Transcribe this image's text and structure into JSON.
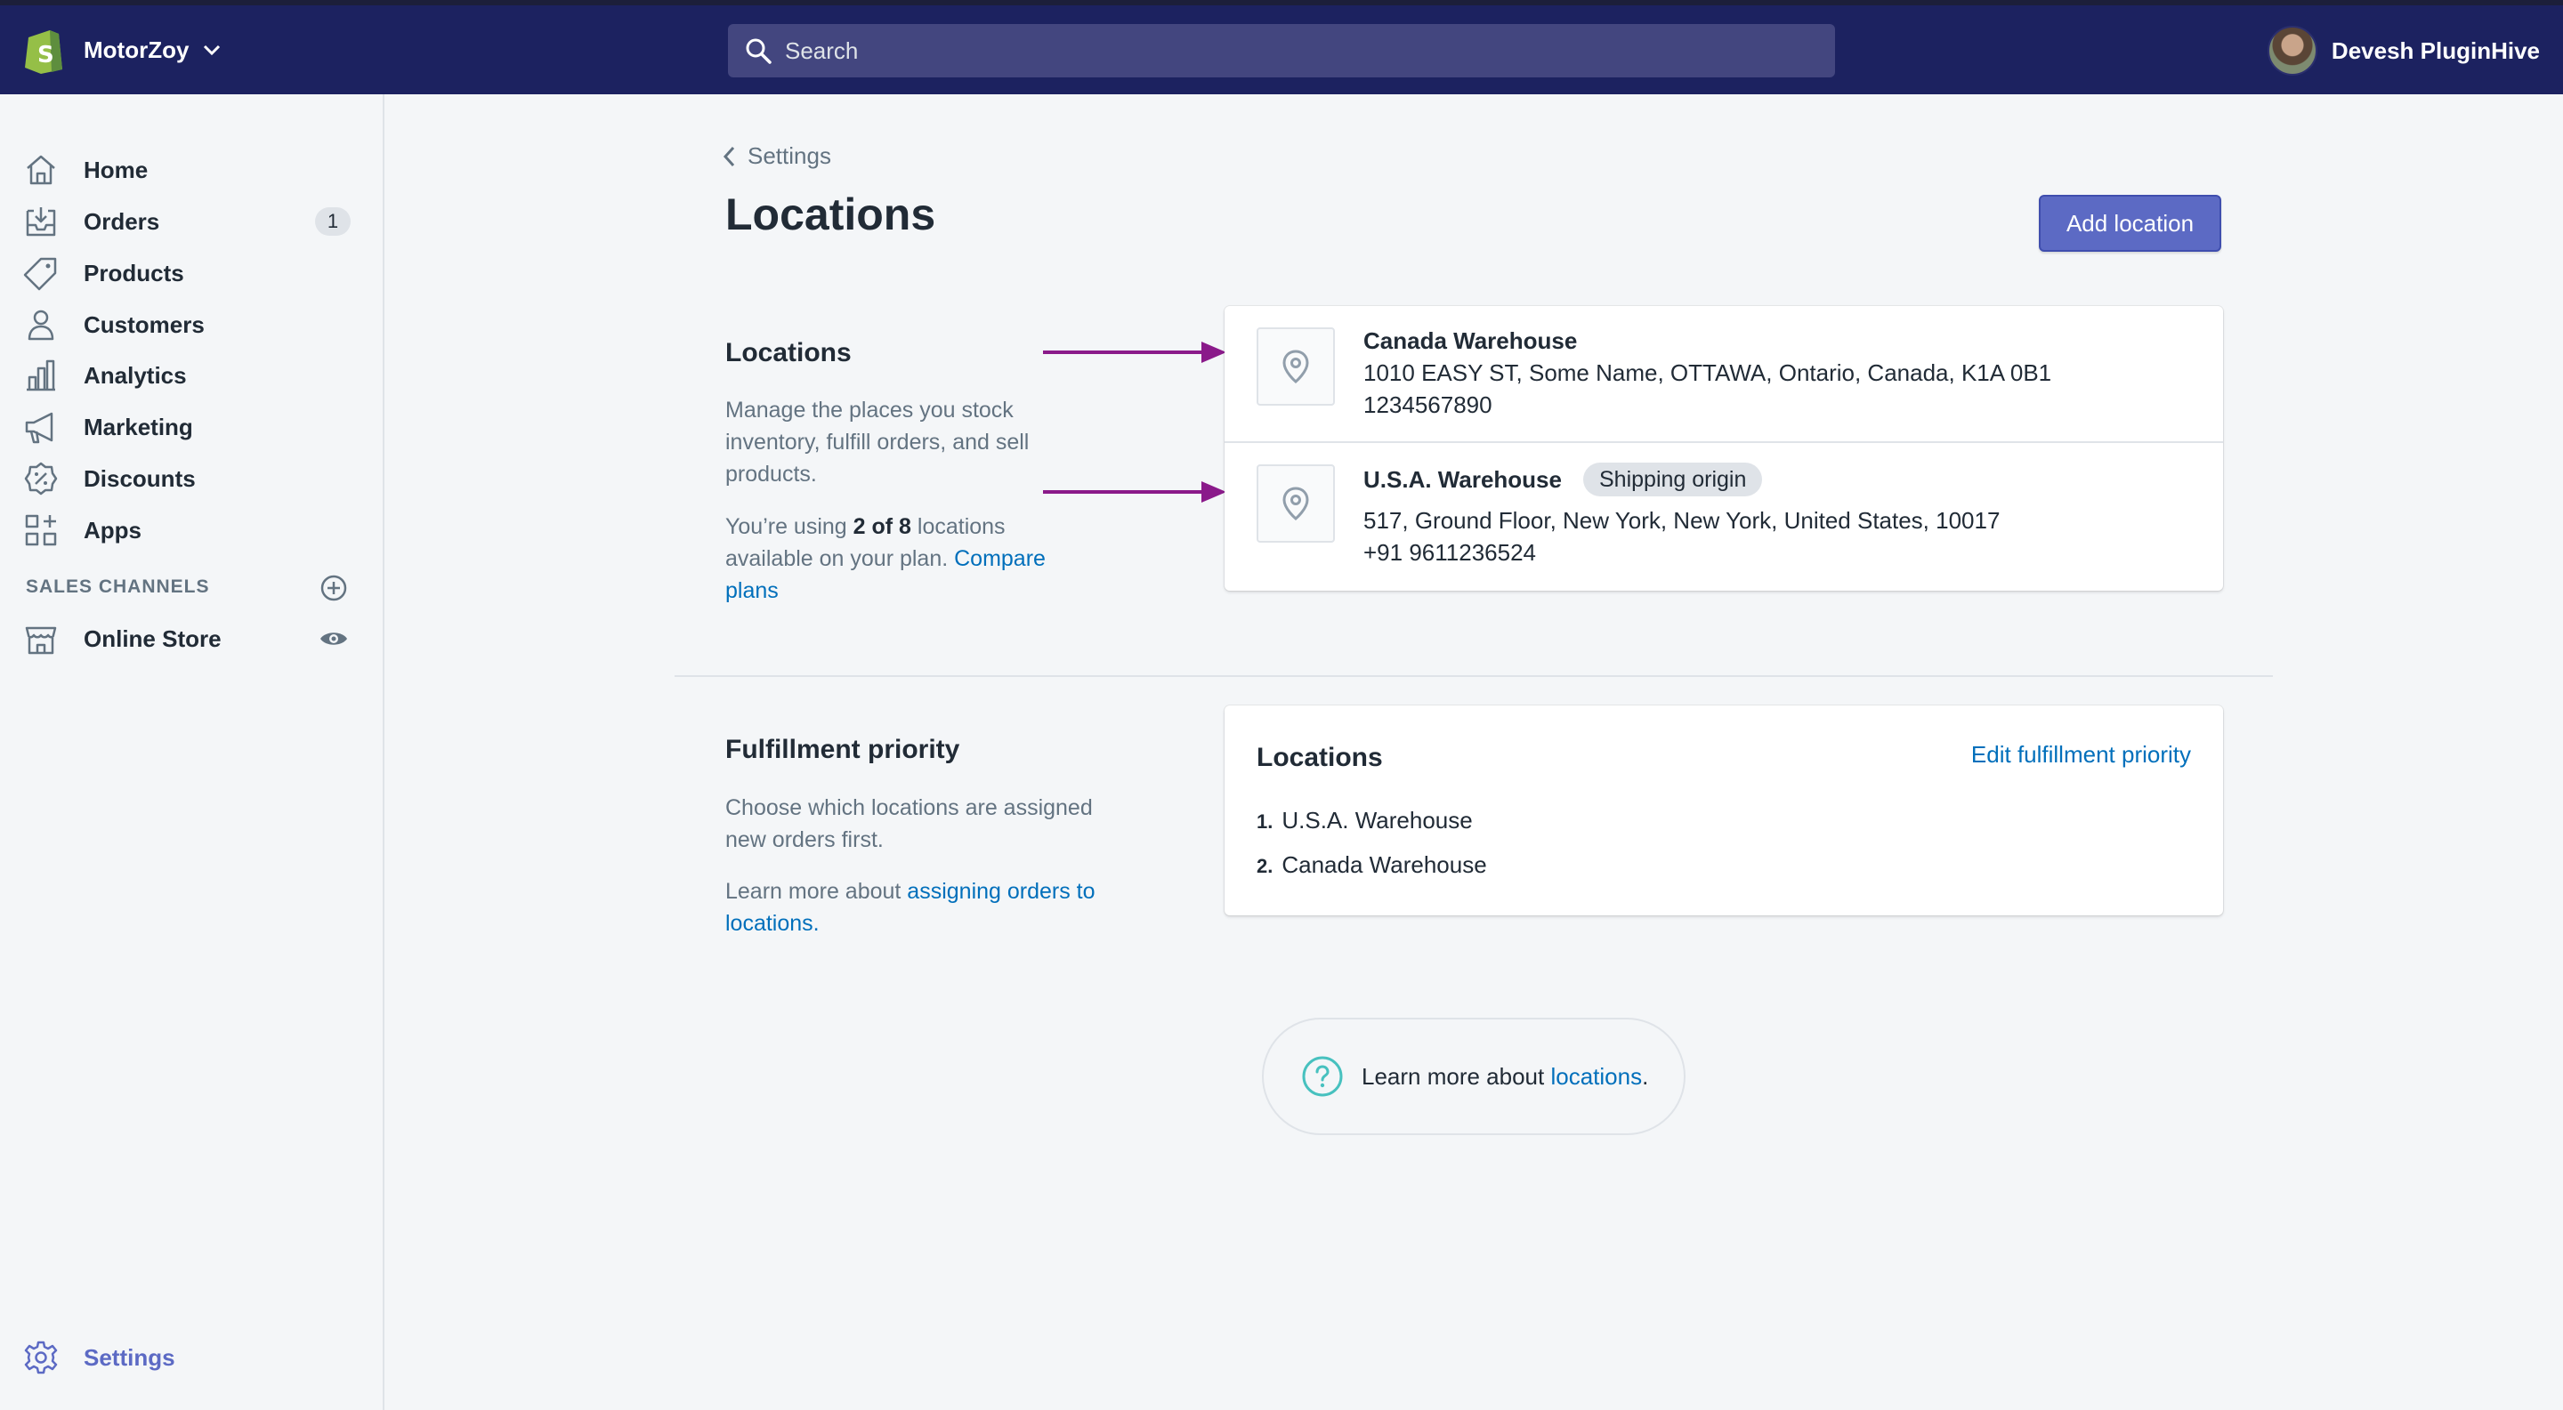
{
  "topbar": {
    "store_name": "MotorZoy",
    "search_placeholder": "Search",
    "user_name": "Devesh PluginHive"
  },
  "sidebar": {
    "items": [
      {
        "label": "Home",
        "icon": "home-icon"
      },
      {
        "label": "Orders",
        "icon": "orders-icon",
        "badge": "1"
      },
      {
        "label": "Products",
        "icon": "tag-icon"
      },
      {
        "label": "Customers",
        "icon": "person-icon"
      },
      {
        "label": "Analytics",
        "icon": "bar-chart-icon"
      },
      {
        "label": "Marketing",
        "icon": "megaphone-icon"
      },
      {
        "label": "Discounts",
        "icon": "discount-icon"
      },
      {
        "label": "Apps",
        "icon": "apps-icon"
      }
    ],
    "sales_channels_heading": "SALES CHANNELS",
    "online_store_label": "Online Store",
    "settings_label": "Settings"
  },
  "page": {
    "breadcrumb": "Settings",
    "title": "Locations",
    "add_button": "Add location"
  },
  "locations_section": {
    "heading": "Locations",
    "description": "Manage the places you stock inventory, fulfill orders, and sell products.",
    "usage_prefix": "You’re using ",
    "usage_count": "2 of 8",
    "usage_suffix": " locations available on your plan. ",
    "compare_link": "Compare plans",
    "locations": [
      {
        "name": "Canada Warehouse",
        "address": "1010 EASY ST, Some Name, OTTAWA, Ontario, Canada, K1A 0B1",
        "phone": "1234567890"
      },
      {
        "name": "U.S.A. Warehouse",
        "badge": "Shipping origin",
        "address": "517, Ground Floor, New York, New York, United States, 10017",
        "phone": "+91 9611236524"
      }
    ]
  },
  "fulfillment_section": {
    "heading": "Fulfillment priority",
    "description": "Choose which locations are assigned new orders first.",
    "learn_prefix": "Learn more about ",
    "learn_link": "assigning orders to locations.",
    "card_title": "Locations",
    "edit_link": "Edit fulfillment priority",
    "priority": [
      {
        "num": "1.",
        "name": "U.S.A. Warehouse"
      },
      {
        "num": "2.",
        "name": "Canada Warehouse"
      }
    ]
  },
  "help": {
    "prefix": "Learn more about ",
    "link": "locations",
    "suffix": "."
  },
  "colors": {
    "topbar": "#1c2260",
    "primary": "#5c6ac4",
    "link": "#006fbb",
    "arrow": "#8a1a8a"
  }
}
